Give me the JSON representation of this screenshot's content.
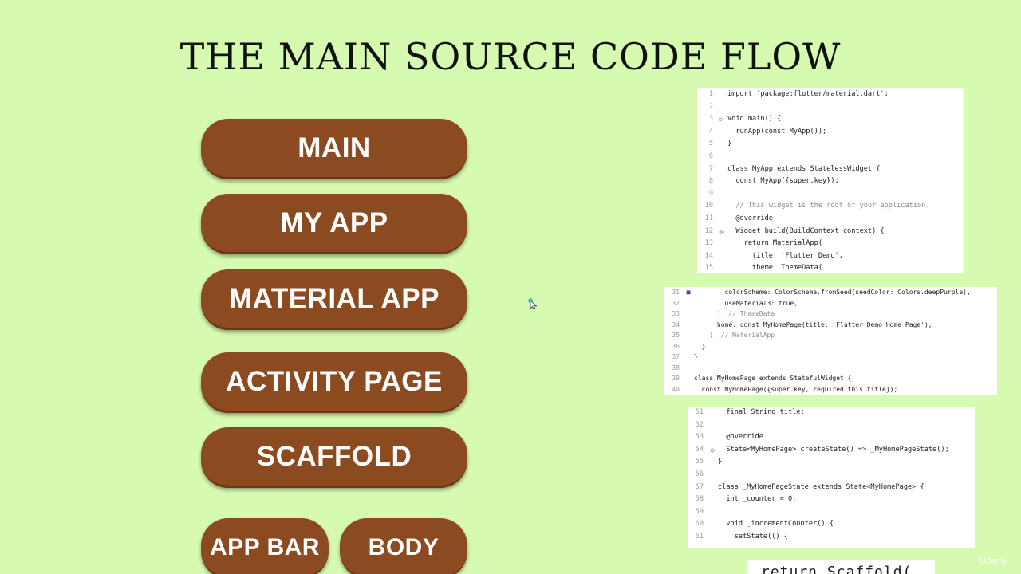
{
  "title": "THE MAIN SOURCE CODE FLOW",
  "buttons": {
    "main": "MAIN",
    "my_app": "MY APP",
    "material_app": "MATERIAL APP",
    "activity_page": "ACTIVITY PAGE",
    "scaffold": "SCAFFOLD",
    "app_bar": "APP BAR",
    "body": "BODY"
  },
  "colors": {
    "background": "#d6fbb0",
    "pill": "#8b4a1f",
    "pill_text": "#ffffff",
    "code_keyword": "#0033b3",
    "code_string": "#067d17",
    "code_comment": "#8c8c8c",
    "code_class": "#3a7fc1"
  },
  "code_panel_1": [
    {
      "n": "1",
      "g": "",
      "t": "import 'package:flutter/material.dart';"
    },
    {
      "n": "2",
      "g": "",
      "t": ""
    },
    {
      "n": "3",
      "g": "▷",
      "t": "void main() {"
    },
    {
      "n": "4",
      "g": "",
      "t": "  runApp(const MyApp());"
    },
    {
      "n": "5",
      "g": "",
      "t": "}"
    },
    {
      "n": "6",
      "g": "",
      "t": ""
    },
    {
      "n": "7",
      "g": "",
      "t": "class MyApp extends StatelessWidget {"
    },
    {
      "n": "8",
      "g": "",
      "t": "  const MyApp({super.key});"
    },
    {
      "n": "9",
      "g": "",
      "t": ""
    },
    {
      "n": "10",
      "g": "",
      "t": "  // This widget is the root of your application."
    },
    {
      "n": "11",
      "g": "",
      "t": "  @override"
    },
    {
      "n": "12",
      "g": "◎",
      "t": "  Widget build(BuildContext context) {"
    },
    {
      "n": "13",
      "g": "",
      "t": "    return MaterialApp("
    },
    {
      "n": "14",
      "g": "",
      "t": "      title: 'Flutter Demo',"
    },
    {
      "n": "15",
      "g": "",
      "t": "      theme: ThemeData("
    }
  ],
  "code_panel_2": [
    {
      "n": "31",
      "g": "■",
      "t": "        colorScheme: ColorScheme.fromSeed(seedColor: Colors.deepPurple),"
    },
    {
      "n": "32",
      "g": "",
      "t": "        useMaterial3: true,"
    },
    {
      "n": "33",
      "g": "",
      "t": "      ), // ThemeData"
    },
    {
      "n": "34",
      "g": "",
      "t": "      home: const MyHomePage(title: 'Flutter Demo Home Page'),"
    },
    {
      "n": "35",
      "g": "",
      "t": "    ); // MaterialApp"
    },
    {
      "n": "36",
      "g": "",
      "t": "  }"
    },
    {
      "n": "37",
      "g": "",
      "t": "}"
    },
    {
      "n": "38",
      "g": "",
      "t": ""
    },
    {
      "n": "39",
      "g": "",
      "t": "class MyHomePage extends StatefulWidget {"
    },
    {
      "n": "40",
      "g": "",
      "t": "  const MyHomePage({super.key, required this.title});"
    }
  ],
  "code_panel_3": [
    {
      "n": "51",
      "g": "",
      "t": "  final String title;"
    },
    {
      "n": "52",
      "g": "",
      "t": ""
    },
    {
      "n": "53",
      "g": "",
      "t": "  @override"
    },
    {
      "n": "54",
      "g": "◎",
      "t": "  State<MyHomePage> createState() => _MyHomePageState();"
    },
    {
      "n": "55",
      "g": "",
      "t": "}"
    },
    {
      "n": "56",
      "g": "",
      "t": ""
    },
    {
      "n": "57",
      "g": "",
      "t": "class _MyHomePageState extends State<MyHomePage> {"
    },
    {
      "n": "58",
      "g": "",
      "t": "  int _counter = 0;"
    },
    {
      "n": "59",
      "g": "",
      "t": ""
    },
    {
      "n": "60",
      "g": "",
      "t": "  void _incrementCounter() {"
    },
    {
      "n": "61",
      "g": "",
      "t": "    setState(() {"
    }
  ],
  "code_panel_4": "return Scaffold(",
  "watermark": "Udemy"
}
